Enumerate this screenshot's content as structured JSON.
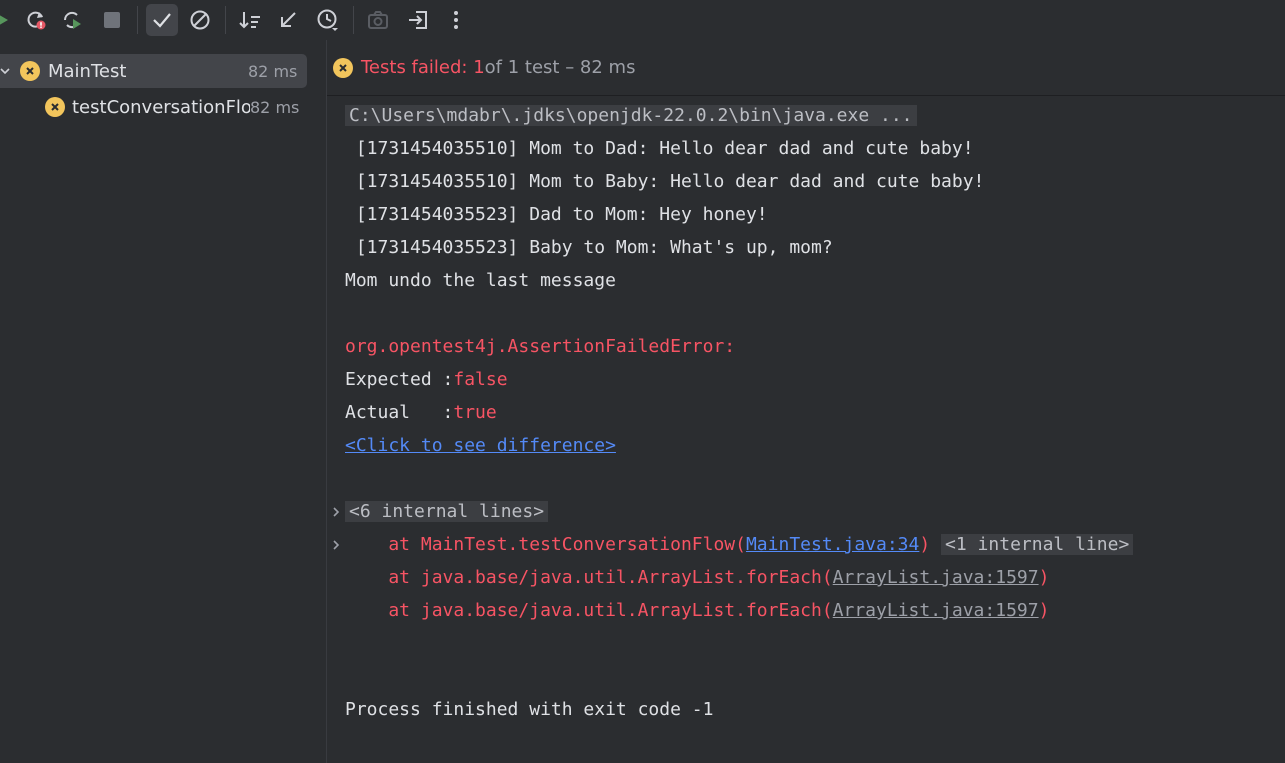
{
  "toolbar": {
    "icons": [
      "rerun-icon",
      "rerun-failed-icon",
      "rerun-toggle-icon",
      "stop-icon",
      "show-passed-icon",
      "show-ignored-icon",
      "sort-icon",
      "collapse-icon",
      "history-icon",
      "screenshot-icon",
      "export-icon",
      "more-icon"
    ]
  },
  "tree": {
    "root": {
      "name": "MainTest",
      "time": "82 ms"
    },
    "child": {
      "name": "testConversationFlow",
      "time": "82 ms"
    }
  },
  "status": {
    "failed_label": "Tests failed: 1",
    "rest": " of 1 test – 82 ms"
  },
  "console": {
    "command": "C:\\Users\\mdabr\\.jdks\\openjdk-22.0.2\\bin\\java.exe ...",
    "lines": [
      " [1731454035510] Mom to Dad: Hello dear dad and cute baby!",
      " [1731454035510] Mom to Baby: Hello dear dad and cute baby!",
      " [1731454035523] Dad to Mom: Hey honey!",
      " [1731454035523] Baby to Mom: What's up, mom?",
      "Mom undo the last message"
    ],
    "error": "org.opentest4j.AssertionFailedError:",
    "expected_label": "Expected :",
    "expected_value": "false",
    "actual_label": "Actual   :",
    "actual_value": "true",
    "diff_link": "<Click to see difference>",
    "internal_lines": "<6 internal lines>",
    "trace1_prefix": "    at MainTest.testConversationFlow(",
    "trace1_link": "MainTest.java:34",
    "trace1_suffix": ")",
    "trace1_internal": "<1 internal line>",
    "trace2_prefix": "    at java.base/java.util.ArrayList.forEach(",
    "trace2_link": "ArrayList.java:1597",
    "trace2_suffix": ")",
    "trace3_prefix": "    at java.base/java.util.ArrayList.forEach(",
    "trace3_link": "ArrayList.java:1597",
    "trace3_suffix": ")",
    "exit": "Process finished with exit code -1"
  },
  "colors": {
    "error": "#f75464",
    "link": "#548af7",
    "warning_badge": "#f2c55c"
  }
}
